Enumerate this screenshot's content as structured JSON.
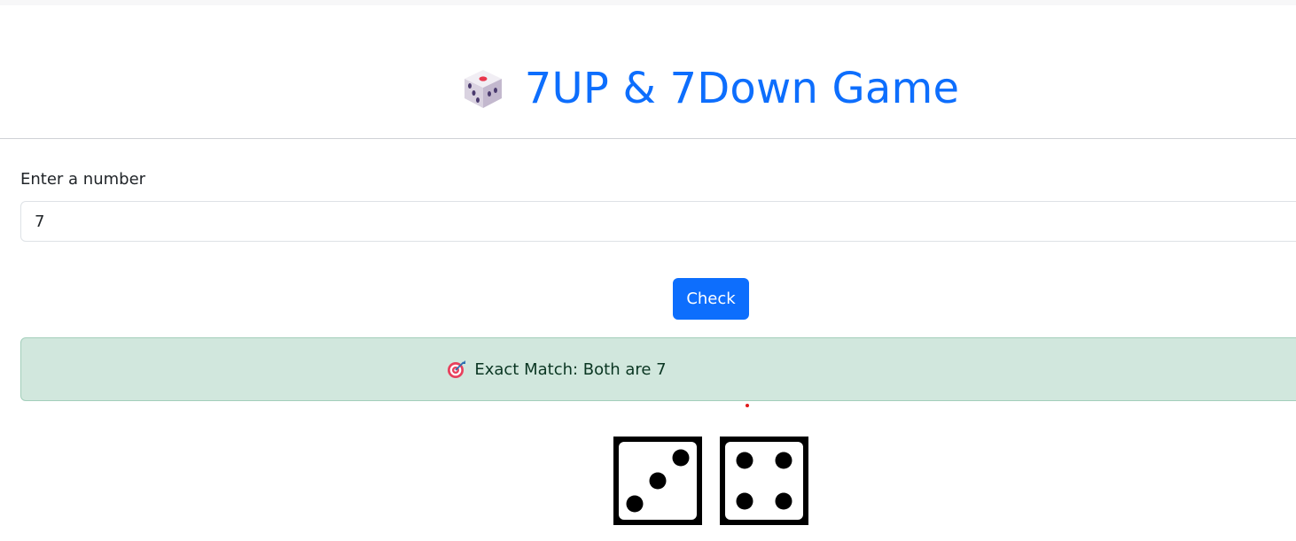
{
  "header": {
    "title": "7UP & 7Down Game",
    "title_icon": "dice-icon",
    "title_color": "#0d6efd"
  },
  "form": {
    "label": "Enter a number",
    "input_value": "7",
    "check_button_label": "Check",
    "button_color": "#0d6efd"
  },
  "result": {
    "icon": "target-icon",
    "message": "Exact Match: Both are 7",
    "background": "#d1e7dd"
  },
  "dice": [
    {
      "face": 3,
      "icon": "die-three-icon"
    },
    {
      "face": 4,
      "icon": "die-four-icon"
    }
  ]
}
